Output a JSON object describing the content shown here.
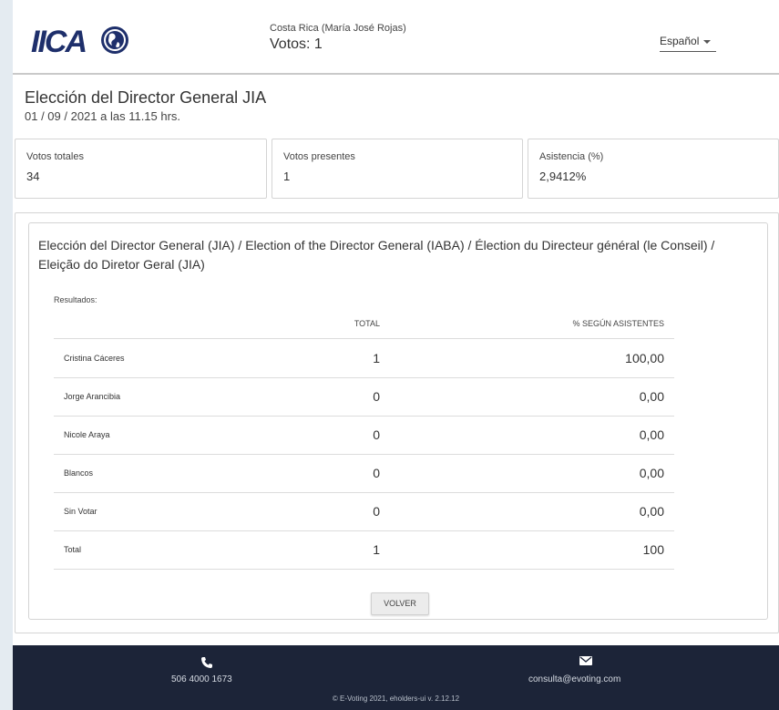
{
  "header": {
    "logo_text": "IICA",
    "country": "Costa Rica (María José Rojas)",
    "votes": "Votos: 1",
    "language": "Español"
  },
  "election": {
    "title": "Elección del Director General JIA",
    "date": "01 / 09 / 2021 a las 11.15 hrs."
  },
  "stats": [
    {
      "label": "Votos totales",
      "value": "34"
    },
    {
      "label": "Votos presentes",
      "value": "1"
    },
    {
      "label": "Asistencia (%)",
      "value": "2,9412%"
    }
  ],
  "results": {
    "title": "Elección del Director General (JIA) / Election of the Director General (IABA) / Élection du Directeur général (le Conseil) / Eleição do Diretor Geral (JIA)",
    "label": "Resultados:",
    "headers": {
      "total": "TOTAL",
      "pct": "% SEGÚN ASISTENTES"
    },
    "rows": [
      {
        "name": "Cristina Cáceres",
        "total": "1",
        "pct": "100,00"
      },
      {
        "name": "Jorge Arancibia",
        "total": "0",
        "pct": "0,00"
      },
      {
        "name": "Nicole Araya",
        "total": "0",
        "pct": "0,00"
      },
      {
        "name": "Blancos",
        "total": "0",
        "pct": "0,00"
      },
      {
        "name": "Sin Votar",
        "total": "0",
        "pct": "0,00"
      },
      {
        "name": "Total",
        "total": "1",
        "pct": "100"
      }
    ],
    "back_button": "VOLVER"
  },
  "footer": {
    "phone": "506 4000 1673",
    "email": "consulta@evoting.com",
    "copyright": "© E-Voting 2021, eholders-ui v. 2.12.12",
    "phone_icon": "phone-icon",
    "mail_icon": "mail-icon"
  },
  "colors": {
    "footer_bg": "#1c2438",
    "logo_blue": "#1e2f6b",
    "page_bg": "#e4ebf1"
  }
}
